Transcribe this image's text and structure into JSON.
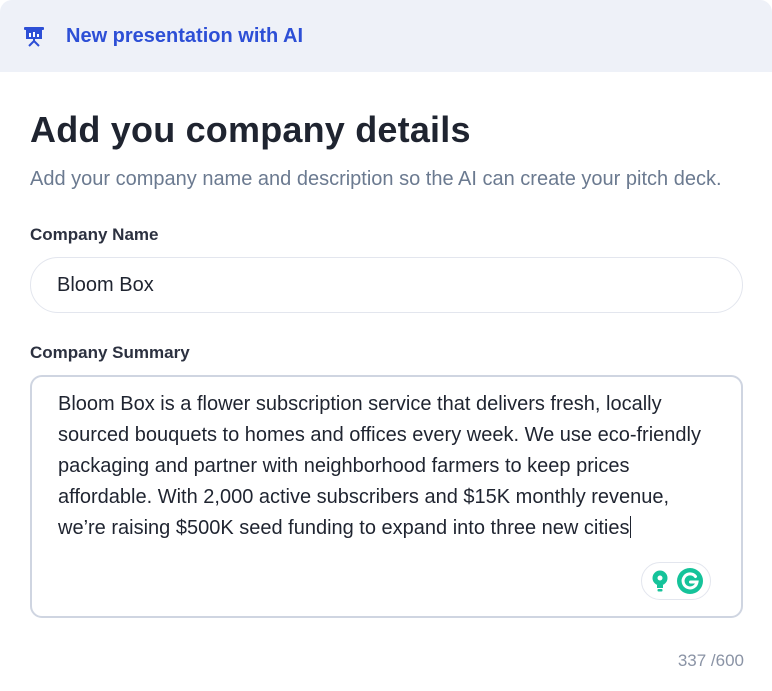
{
  "header": {
    "title": "New presentation with AI",
    "icon": "presentation-board-icon",
    "accent_color": "#2d4fd6"
  },
  "main": {
    "title": "Add you company details",
    "subtitle": "Add your company name and description so the AI can create your pitch deck.",
    "company_name": {
      "label": "Company Name",
      "value": "Bloom Box"
    },
    "company_summary": {
      "label": "Company Summary",
      "value": "Bloom Box is a flower subscription service that delivers fresh, locally sourced bouquets to homes and offices every week. We use eco-friendly packaging and partner with neighborhood farmers to keep prices affordable. With 2,000 active subscribers and $15K monthly revenue, we’re raising $500K seed funding to expand into three new cities",
      "counter": "337 /600"
    },
    "assist_widget": {
      "icons": [
        "lightbulb-icon",
        "grammarly-g-icon"
      ],
      "color": "#15c39a"
    }
  }
}
